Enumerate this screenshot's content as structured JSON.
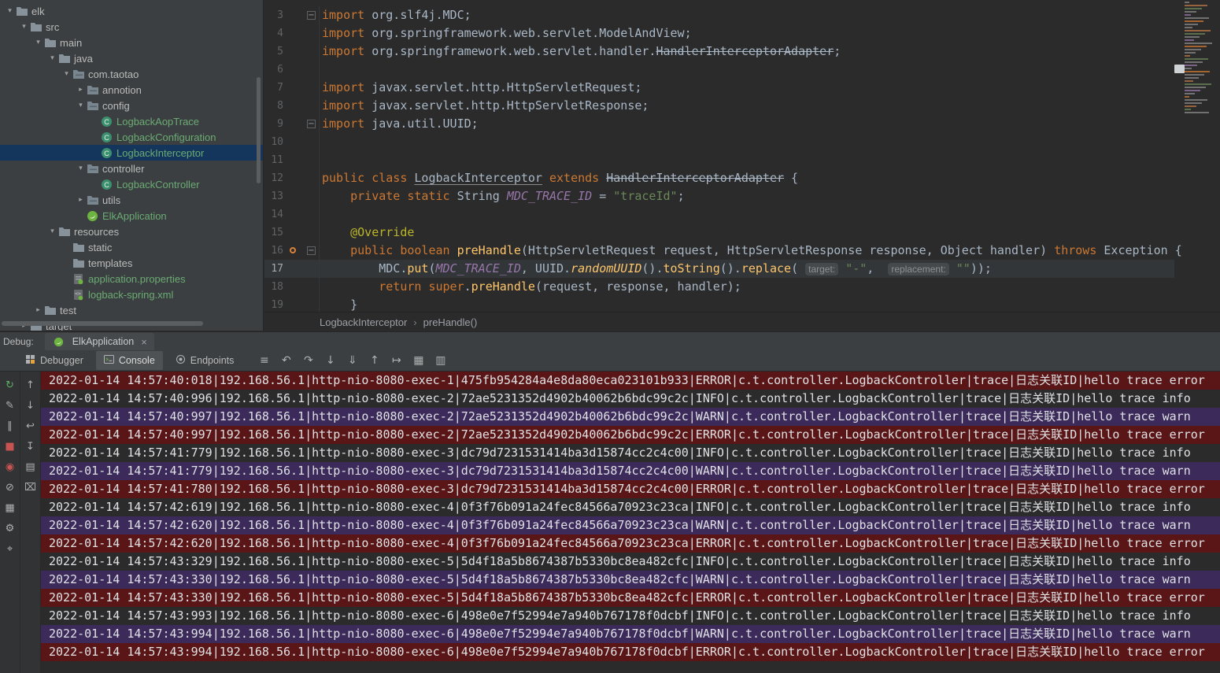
{
  "colors": {
    "error_row_bg": "#5a1616",
    "warn_row_bg": "#3b2a5a",
    "info_row_bg": "transparent",
    "git_added_text": "#6aab73",
    "tree_selection_bg": "#14365c",
    "keyword": "#cc7832",
    "string": "#6a8759"
  },
  "project_tree": {
    "items": [
      {
        "label": "elk",
        "indent": 0,
        "arrow": "down",
        "icon": "folder"
      },
      {
        "label": "src",
        "indent": 1,
        "arrow": "down",
        "icon": "folder"
      },
      {
        "label": "main",
        "indent": 2,
        "arrow": "down",
        "icon": "folder"
      },
      {
        "label": "java",
        "indent": 3,
        "arrow": "down",
        "icon": "folder"
      },
      {
        "label": "com.taotao",
        "indent": 4,
        "arrow": "down",
        "icon": "package"
      },
      {
        "label": "annotion",
        "indent": 5,
        "arrow": "right",
        "icon": "package"
      },
      {
        "label": "config",
        "indent": 5,
        "arrow": "down",
        "icon": "package"
      },
      {
        "label": "LogbackAopTrace",
        "indent": 6,
        "arrow": null,
        "icon": "class",
        "git": "added"
      },
      {
        "label": "LogbackConfiguration",
        "indent": 6,
        "arrow": null,
        "icon": "class",
        "git": "added"
      },
      {
        "label": "LogbackInterceptor",
        "indent": 6,
        "arrow": null,
        "icon": "class",
        "git": "added",
        "selected": true
      },
      {
        "label": "controller",
        "indent": 5,
        "arrow": "down",
        "icon": "package"
      },
      {
        "label": "LogbackController",
        "indent": 6,
        "arrow": null,
        "icon": "class",
        "git": "added"
      },
      {
        "label": "utils",
        "indent": 5,
        "arrow": "right",
        "icon": "package"
      },
      {
        "label": "ElkApplication",
        "indent": 5,
        "arrow": null,
        "icon": "spring",
        "git": "added"
      },
      {
        "label": "resources",
        "indent": 3,
        "arrow": "down",
        "icon": "folder"
      },
      {
        "label": "static",
        "indent": 4,
        "arrow": null,
        "icon": "folder"
      },
      {
        "label": "templates",
        "indent": 4,
        "arrow": null,
        "icon": "folder"
      },
      {
        "label": "application.properties",
        "indent": 4,
        "arrow": null,
        "icon": "properties",
        "git": "added"
      },
      {
        "label": "logback-spring.xml",
        "indent": 4,
        "arrow": null,
        "icon": "xml",
        "git": "added"
      },
      {
        "label": "test",
        "indent": 2,
        "arrow": "right",
        "icon": "folder"
      },
      {
        "label": "target",
        "indent": 1,
        "arrow": "right",
        "icon": "folder"
      }
    ]
  },
  "editor": {
    "current_line": 17,
    "breadcrumbs": {
      "items": [
        "LogbackInterceptor",
        "preHandle()"
      ],
      "separator": "›"
    },
    "lines": [
      {
        "num": 3,
        "fold": true,
        "tokens": [
          {
            "t": "import",
            "c": "kw"
          },
          {
            "t": " org.slf4j.MDC;",
            "c": "plain"
          }
        ]
      },
      {
        "num": 4,
        "tokens": [
          {
            "t": "import",
            "c": "kw"
          },
          {
            "t": " org.springframework.web.servlet.ModelAndView;",
            "c": "plain"
          }
        ]
      },
      {
        "num": 5,
        "tokens": [
          {
            "t": "import",
            "c": "kw"
          },
          {
            "t": " org.springframework.web.servlet.handler.",
            "c": "plain"
          },
          {
            "t": "HandlerInterceptorAdapter",
            "c": "plain strike"
          },
          {
            "t": ";",
            "c": "plain"
          }
        ]
      },
      {
        "num": 6,
        "tokens": []
      },
      {
        "num": 7,
        "tokens": [
          {
            "t": "import",
            "c": "kw"
          },
          {
            "t": " javax.servlet.http.HttpServletRequest;",
            "c": "plain"
          }
        ]
      },
      {
        "num": 8,
        "tokens": [
          {
            "t": "import",
            "c": "kw"
          },
          {
            "t": " javax.servlet.http.HttpServletResponse;",
            "c": "plain"
          }
        ]
      },
      {
        "num": 9,
        "fold": true,
        "tokens": [
          {
            "t": "import",
            "c": "kw"
          },
          {
            "t": " java.util.UUID;",
            "c": "plain"
          }
        ]
      },
      {
        "num": 10,
        "tokens": []
      },
      {
        "num": 11,
        "tokens": []
      },
      {
        "num": 12,
        "tokens": [
          {
            "t": "public class ",
            "c": "kw"
          },
          {
            "t": "LogbackInterceptor",
            "c": "plain und"
          },
          {
            "t": " extends ",
            "c": "kw"
          },
          {
            "t": "HandlerInterceptorAdapter",
            "c": "plain strike"
          },
          {
            "t": " {",
            "c": "plain"
          }
        ]
      },
      {
        "num": 13,
        "tokens": [
          {
            "t": "    ",
            "c": "plain"
          },
          {
            "t": "private static ",
            "c": "kw"
          },
          {
            "t": "String ",
            "c": "plain"
          },
          {
            "t": "MDC_TRACE_ID",
            "c": "field"
          },
          {
            "t": " = ",
            "c": "plain"
          },
          {
            "t": "\"traceId\"",
            "c": "str"
          },
          {
            "t": ";",
            "c": "plain"
          }
        ]
      },
      {
        "num": 14,
        "tokens": []
      },
      {
        "num": 15,
        "tokens": [
          {
            "t": "    ",
            "c": "plain"
          },
          {
            "t": "@Override",
            "c": "annot"
          }
        ]
      },
      {
        "num": 16,
        "fold": true,
        "icon": "override",
        "tokens": [
          {
            "t": "    ",
            "c": "plain"
          },
          {
            "t": "public boolean ",
            "c": "kw"
          },
          {
            "t": "preHandle",
            "c": "method"
          },
          {
            "t": "(HttpServletRequest request, HttpServletResponse response, Object handler) ",
            "c": "plain"
          },
          {
            "t": "throws",
            "c": "kw"
          },
          {
            "t": " Exception {",
            "c": "plain"
          }
        ]
      },
      {
        "num": 17,
        "tokens": [
          {
            "t": "        MDC.",
            "c": "plain"
          },
          {
            "t": "put",
            "c": "method"
          },
          {
            "t": "(",
            "c": "plain"
          },
          {
            "t": "MDC_TRACE_ID",
            "c": "field"
          },
          {
            "t": ", UUID.",
            "c": "plain"
          },
          {
            "t": "randomUUID",
            "c": "smethod"
          },
          {
            "t": "().",
            "c": "plain"
          },
          {
            "t": "toString",
            "c": "method"
          },
          {
            "t": "().",
            "c": "plain"
          },
          {
            "t": "replace",
            "c": "method"
          },
          {
            "t": "( ",
            "c": "plain"
          },
          {
            "t": "target:",
            "c": "hint"
          },
          {
            "t": " ",
            "c": "plain"
          },
          {
            "t": "\"-\"",
            "c": "str"
          },
          {
            "t": ",  ",
            "c": "plain"
          },
          {
            "t": "replacement:",
            "c": "hint"
          },
          {
            "t": " ",
            "c": "plain"
          },
          {
            "t": "\"\"",
            "c": "str"
          },
          {
            "t": "));",
            "c": "plain"
          }
        ]
      },
      {
        "num": 18,
        "tokens": [
          {
            "t": "        ",
            "c": "plain"
          },
          {
            "t": "return super",
            "c": "kw"
          },
          {
            "t": ".",
            "c": "plain"
          },
          {
            "t": "preHandle",
            "c": "method"
          },
          {
            "t": "(request, response, handler);",
            "c": "plain"
          }
        ]
      },
      {
        "num": 19,
        "tokens": [
          {
            "t": "    }",
            "c": "plain"
          }
        ]
      }
    ]
  },
  "debug": {
    "panel_label": "Debug:",
    "session": {
      "label": "ElkApplication",
      "close": "×"
    },
    "tabs": [
      {
        "label": "Debugger",
        "icon": "debugger-icon",
        "selected": false
      },
      {
        "label": "Console",
        "icon": "console-icon",
        "selected": true
      },
      {
        "label": "Endpoints",
        "icon": "endpoints-icon",
        "selected": false
      }
    ],
    "toolbar_icons": [
      {
        "name": "menu-icon",
        "glyph": "≡"
      },
      {
        "name": "show-execution-point-icon",
        "glyph": "↶"
      },
      {
        "name": "step-over-icon",
        "glyph": "↷"
      },
      {
        "name": "step-into-icon",
        "glyph": "↓"
      },
      {
        "name": "force-step-into-icon",
        "glyph": "⇓"
      },
      {
        "name": "step-out-icon",
        "glyph": "↑"
      },
      {
        "name": "run-to-cursor-icon",
        "glyph": "↦"
      },
      {
        "name": "evaluate-expression-icon",
        "glyph": "▦"
      },
      {
        "name": "layout-settings-icon",
        "glyph": "▥"
      }
    ],
    "debug_strip_icons": [
      {
        "name": "rerun-icon",
        "glyph": "↻",
        "color": "#5fad65"
      },
      {
        "name": "edit-configuration-icon",
        "glyph": "✎",
        "color": "#afb1b3"
      },
      {
        "name": "pause-icon",
        "glyph": "∥",
        "color": "#afb1b3"
      },
      {
        "name": "stop-icon",
        "glyph": "■",
        "color": "#c75450"
      },
      {
        "name": "view-breakpoints-icon",
        "glyph": "◉",
        "color": "#c75450"
      },
      {
        "name": "mute-breakpoints-icon",
        "glyph": "⊘",
        "color": "#afb1b3"
      },
      {
        "name": "restore-layout-icon",
        "glyph": "▦",
        "color": "#afb1b3"
      },
      {
        "name": "settings-icon",
        "glyph": "⚙",
        "color": "#afb1b3"
      },
      {
        "name": "pin-icon",
        "glyph": "⌖",
        "color": "#afb1b3"
      }
    ],
    "console_strip_icons": [
      {
        "name": "up-stack-trace-icon",
        "glyph": "↑",
        "color": "#afb1b3"
      },
      {
        "name": "down-stack-trace-icon",
        "glyph": "↓",
        "color": "#afb1b3"
      },
      {
        "name": "soft-wrap-icon",
        "glyph": "↩",
        "color": "#afb1b3"
      },
      {
        "name": "scroll-to-end-icon",
        "glyph": "↧",
        "color": "#afb1b3"
      },
      {
        "name": "print-icon",
        "glyph": "▤",
        "color": "#afb1b3"
      },
      {
        "name": "clear-all-icon",
        "glyph": "⌧",
        "color": "#afb1b3"
      }
    ],
    "console": {
      "lines": [
        {
          "level": "ERROR",
          "text": "2022-01-14 14:57:40:018|192.168.56.1|http-nio-8080-exec-1|475fb954284a4e8da80eca023101b933|ERROR|c.t.controller.LogbackController|trace|日志关联ID|hello trace error"
        },
        {
          "level": "INFO",
          "text": "2022-01-14 14:57:40:996|192.168.56.1|http-nio-8080-exec-2|72ae5231352d4902b40062b6bdc99c2c|INFO|c.t.controller.LogbackController|trace|日志关联ID|hello trace info"
        },
        {
          "level": "WARN",
          "text": "2022-01-14 14:57:40:997|192.168.56.1|http-nio-8080-exec-2|72ae5231352d4902b40062b6bdc99c2c|WARN|c.t.controller.LogbackController|trace|日志关联ID|hello trace warn"
        },
        {
          "level": "ERROR",
          "text": "2022-01-14 14:57:40:997|192.168.56.1|http-nio-8080-exec-2|72ae5231352d4902b40062b6bdc99c2c|ERROR|c.t.controller.LogbackController|trace|日志关联ID|hello trace error"
        },
        {
          "level": "INFO",
          "text": "2022-01-14 14:57:41:779|192.168.56.1|http-nio-8080-exec-3|dc79d7231531414ba3d15874cc2c4c00|INFO|c.t.controller.LogbackController|trace|日志关联ID|hello trace info"
        },
        {
          "level": "WARN",
          "text": "2022-01-14 14:57:41:779|192.168.56.1|http-nio-8080-exec-3|dc79d7231531414ba3d15874cc2c4c00|WARN|c.t.controller.LogbackController|trace|日志关联ID|hello trace warn"
        },
        {
          "level": "ERROR",
          "text": "2022-01-14 14:57:41:780|192.168.56.1|http-nio-8080-exec-3|dc79d7231531414ba3d15874cc2c4c00|ERROR|c.t.controller.LogbackController|trace|日志关联ID|hello trace error"
        },
        {
          "level": "INFO",
          "text": "2022-01-14 14:57:42:619|192.168.56.1|http-nio-8080-exec-4|0f3f76b091a24fec84566a70923c23ca|INFO|c.t.controller.LogbackController|trace|日志关联ID|hello trace info"
        },
        {
          "level": "WARN",
          "text": "2022-01-14 14:57:42:620|192.168.56.1|http-nio-8080-exec-4|0f3f76b091a24fec84566a70923c23ca|WARN|c.t.controller.LogbackController|trace|日志关联ID|hello trace warn"
        },
        {
          "level": "ERROR",
          "text": "2022-01-14 14:57:42:620|192.168.56.1|http-nio-8080-exec-4|0f3f76b091a24fec84566a70923c23ca|ERROR|c.t.controller.LogbackController|trace|日志关联ID|hello trace error"
        },
        {
          "level": "INFO",
          "text": "2022-01-14 14:57:43:329|192.168.56.1|http-nio-8080-exec-5|5d4f18a5b8674387b5330bc8ea482cfc|INFO|c.t.controller.LogbackController|trace|日志关联ID|hello trace info"
        },
        {
          "level": "WARN",
          "text": "2022-01-14 14:57:43:330|192.168.56.1|http-nio-8080-exec-5|5d4f18a5b8674387b5330bc8ea482cfc|WARN|c.t.controller.LogbackController|trace|日志关联ID|hello trace warn"
        },
        {
          "level": "ERROR",
          "text": "2022-01-14 14:57:43:330|192.168.56.1|http-nio-8080-exec-5|5d4f18a5b8674387b5330bc8ea482cfc|ERROR|c.t.controller.LogbackController|trace|日志关联ID|hello trace error"
        },
        {
          "level": "INFO",
          "text": "2022-01-14 14:57:43:993|192.168.56.1|http-nio-8080-exec-6|498e0e7f52994e7a940b767178f0dcbf|INFO|c.t.controller.LogbackController|trace|日志关联ID|hello trace info"
        },
        {
          "level": "WARN",
          "text": "2022-01-14 14:57:43:994|192.168.56.1|http-nio-8080-exec-6|498e0e7f52994e7a940b767178f0dcbf|WARN|c.t.controller.LogbackController|trace|日志关联ID|hello trace warn"
        },
        {
          "level": "ERROR",
          "text": "2022-01-14 14:57:43:994|192.168.56.1|http-nio-8080-exec-6|498e0e7f52994e7a940b767178f0dcbf|ERROR|c.t.controller.LogbackController|trace|日志关联ID|hello trace error"
        }
      ]
    }
  }
}
